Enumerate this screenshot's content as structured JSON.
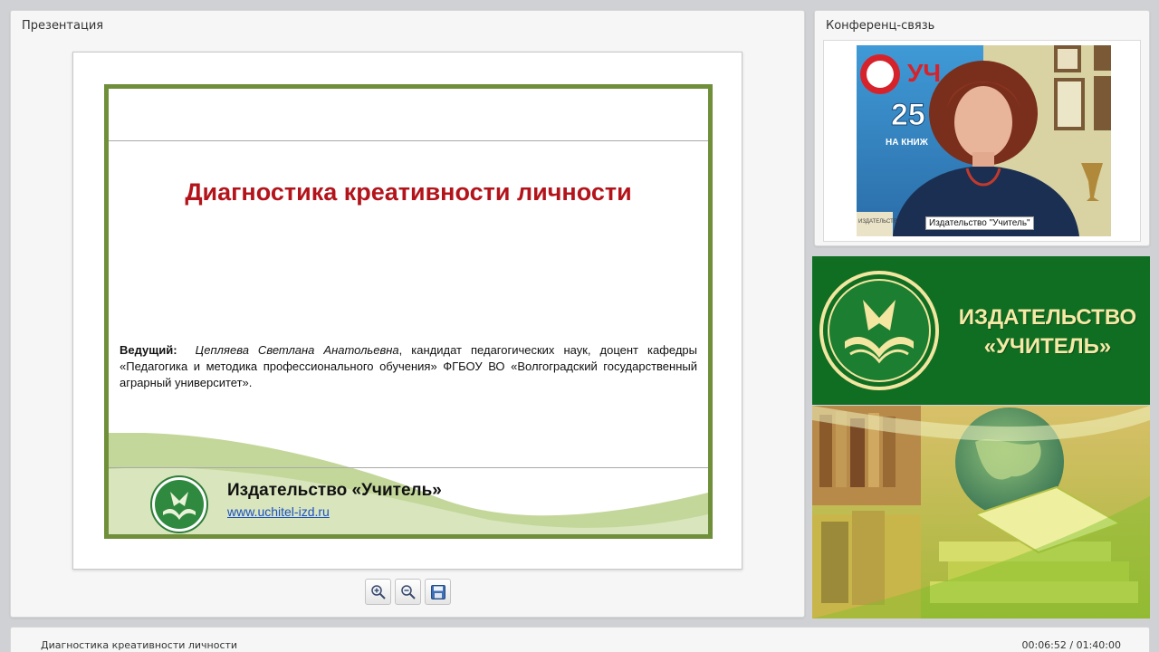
{
  "presentation": {
    "title": "Презентация",
    "slide": {
      "title": "Диагностика креативности личности",
      "presenter_label": "Ведущий:",
      "presenter_name": "Цепляева Светлана Анатольевна",
      "presenter_info": ", кандидат педагогических наук, доцент кафедры «Педагогика и методика профессионального обучения» ФГБОУ ВО «Волгоградский государственный аграрный университет».",
      "publisher": "Издательство «Учитель»",
      "url": "www.uchitel-izd.ru"
    },
    "toolbar": {
      "zoom_in_icon": "zoom-in-icon",
      "zoom_out_icon": "zoom-out-icon",
      "save_icon": "save-icon"
    }
  },
  "conference": {
    "title": "Конференц-связь",
    "participant_label": "Издательство \"Учитель\""
  },
  "banner": {
    "line1": "ИЗДАТЕЛЬСТВО",
    "line2": "«УЧИТЕЛЬ»"
  },
  "status": {
    "title": "Диагностика креативности личности",
    "time": "00:06:52 / 01:40:00"
  },
  "colors": {
    "slide_frame": "#6f8f3a",
    "slide_title": "#b3141b",
    "banner_green": "#0f6e22",
    "banner_text": "#f6e9a6"
  }
}
